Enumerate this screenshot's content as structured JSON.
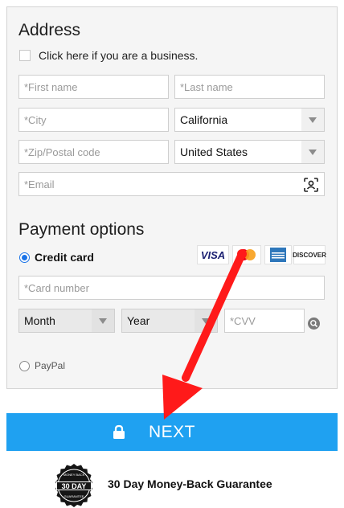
{
  "address": {
    "title": "Address",
    "business_checkbox_label": "Click here if you are a business.",
    "first_name_placeholder": "*First name",
    "last_name_placeholder": "*Last name",
    "city_placeholder": "*City",
    "state_value": "California",
    "zip_placeholder": "*Zip/Postal code",
    "country_value": "United States",
    "email_placeholder": "*Email",
    "email_icon": "contact-scan-icon"
  },
  "payment": {
    "title": "Payment options",
    "credit_card_label": "Credit card",
    "credit_card_selected": true,
    "card_logos": [
      "VISA",
      "MASTERCARD",
      "AMERICAN EXPRESS",
      "DISCOVER"
    ],
    "card_number_placeholder": "*Card number",
    "month_value": "Month",
    "year_value": "Year",
    "cvv_placeholder": "*CVV",
    "cvv_help_icon": "search-icon",
    "paypal_label": "PayPal",
    "paypal_selected": false
  },
  "next_button": {
    "label": "NEXT",
    "icon": "lock-icon",
    "color": "#1fa1f1"
  },
  "guarantee": {
    "text": "30 Day Money-Back Guarantee",
    "badge_text": "30 DAY",
    "badge_ring_top": "MONEY BACK",
    "badge_ring_bottom": "GUARANTEE"
  },
  "annotation": {
    "arrow_color": "#ff1a1a",
    "arrow_icon": "red-arrow-annotation"
  }
}
